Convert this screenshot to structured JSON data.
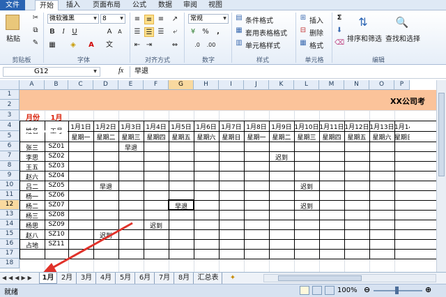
{
  "menu": {
    "file": "文件",
    "tabs": [
      "开始",
      "插入",
      "页面布局",
      "公式",
      "数据",
      "审阅",
      "视图"
    ]
  },
  "ribbon": {
    "paste": "粘贴",
    "font_name": "微软雅黑",
    "font_size": "8",
    "number_format": "常规",
    "conditional_format": "条件格式",
    "table_format": "套用表格格式",
    "cell_style": "单元格样式",
    "insert": "插入",
    "delete": "删除",
    "format": "格式",
    "sort_filter": "排序和筛选",
    "find_select": "查找和选择",
    "groups": {
      "clipboard": "剪贴板",
      "font": "字体",
      "alignment": "对齐方式",
      "number": "数字",
      "styles": "样式",
      "cells": "单元格",
      "editing": "编辑"
    },
    "bold": "B",
    "italic": "I",
    "underline": "U",
    "sum": "Σ",
    "percent": "%",
    "comma": ","
  },
  "formula": {
    "name_box": "G12",
    "fx": "fx",
    "value": "早退"
  },
  "sheet": {
    "columns": [
      "A",
      "B",
      "C",
      "D",
      "E",
      "F",
      "G",
      "H",
      "I",
      "J",
      "K",
      "L",
      "M",
      "N",
      "O",
      "P"
    ],
    "rows": [
      "1",
      "2",
      "3",
      "4",
      "5",
      "6",
      "7",
      "8",
      "9",
      "10",
      "11",
      "12",
      "13",
      "14",
      "15",
      "16",
      "17",
      "18"
    ],
    "title": "XX公司考",
    "month_label": "月份",
    "month_value": "1月",
    "header_name": "姓名",
    "header_id": "工号",
    "dates": [
      "1月1日",
      "1月2日",
      "1月3日",
      "1月4日",
      "1月5日",
      "1月6日",
      "1月7日",
      "1月8日",
      "1月9日",
      "1月10日",
      "1月11日",
      "1月12日",
      "1月13日",
      "1月14日"
    ],
    "weekdays": [
      "星期一",
      "星期二",
      "星期三",
      "星期四",
      "星期五",
      "星期六",
      "星期日",
      "星期一",
      "星期二",
      "星期三",
      "星期四",
      "星期五",
      "星期六",
      "星期日"
    ],
    "employees": [
      {
        "name": "张三",
        "id": "SZ01"
      },
      {
        "name": "李思",
        "id": "SZ02"
      },
      {
        "name": "王五",
        "id": "SZ03"
      },
      {
        "name": "赵六",
        "id": "SZ04"
      },
      {
        "name": "吕二",
        "id": "SZ05"
      },
      {
        "name": "杨一",
        "id": "SZ06"
      },
      {
        "name": "杨二",
        "id": "SZ07"
      },
      {
        "name": "杨三",
        "id": "SZ08"
      },
      {
        "name": "杨思",
        "id": "SZ09"
      },
      {
        "name": "赵八",
        "id": "SZ10"
      },
      {
        "name": "占地",
        "id": "SZ11"
      }
    ],
    "marks": [
      {
        "row": 0,
        "col": 2,
        "text": "早退"
      },
      {
        "row": 1,
        "col": 8,
        "text": "迟到"
      },
      {
        "row": 4,
        "col": 1,
        "text": "早退"
      },
      {
        "row": 4,
        "col": 9,
        "text": "迟到"
      },
      {
        "row": 6,
        "col": 4,
        "text": "早退"
      },
      {
        "row": 6,
        "col": 9,
        "text": "迟到"
      },
      {
        "row": 8,
        "col": 3,
        "text": "迟到"
      },
      {
        "row": 9,
        "col": 1,
        "text": "迟到"
      }
    ]
  },
  "sheet_tabs": [
    "1月",
    "2月",
    "3月",
    "4月",
    "5月",
    "6月",
    "7月",
    "8月",
    "汇总表"
  ],
  "status": {
    "ready": "就绪",
    "zoom": "100%"
  },
  "colors": {
    "title_band": "#fbc39a",
    "month_text": "#d81e06",
    "arrow": "#e0322a"
  }
}
